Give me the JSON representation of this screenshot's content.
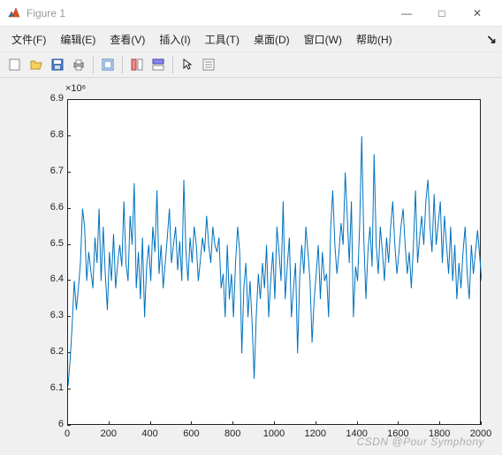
{
  "window": {
    "title": "Figure 1",
    "minimize": "—",
    "maximize": "□",
    "close": "✕"
  },
  "menubar": {
    "items": [
      {
        "label": "文件(F)"
      },
      {
        "label": "编辑(E)"
      },
      {
        "label": "查看(V)"
      },
      {
        "label": "插入(I)"
      },
      {
        "label": "工具(T)"
      },
      {
        "label": "桌面(D)"
      },
      {
        "label": "窗口(W)"
      },
      {
        "label": "帮助(H)"
      }
    ],
    "overflow": "↘"
  },
  "toolbar": {
    "new": "new-figure-icon",
    "open": "open-icon",
    "save": "save-icon",
    "print": "print-icon",
    "edit": "edit-plot-icon",
    "layout1": "layout-icon",
    "layout2": "layout2-icon",
    "pointer": "pointer-icon",
    "props": "properties-icon"
  },
  "watermark": "CSDN @Pour Symphony",
  "chart_data": {
    "type": "line",
    "x_range": [
      0,
      2000
    ],
    "y_range": [
      6.0,
      6.9
    ],
    "y_scale_exponent": "×10⁶",
    "x_ticks": [
      0,
      200,
      400,
      600,
      800,
      1000,
      1200,
      1400,
      1600,
      1800,
      2000
    ],
    "y_ticks": [
      6.0,
      6.1,
      6.2,
      6.3,
      6.4,
      6.5,
      6.6,
      6.7,
      6.8,
      6.9
    ],
    "y_tick_labels": [
      "6",
      "6.1",
      "6.2",
      "6.3",
      "6.4",
      "6.5",
      "6.6",
      "6.7",
      "6.8",
      "6.9"
    ],
    "title": "",
    "xlabel": "",
    "ylabel": "",
    "line_color": "#0072bd",
    "values": [
      6.11,
      6.18,
      6.28,
      6.4,
      6.32,
      6.38,
      6.45,
      6.6,
      6.55,
      6.4,
      6.48,
      6.43,
      6.38,
      6.52,
      6.45,
      6.6,
      6.4,
      6.55,
      6.42,
      6.32,
      6.48,
      6.4,
      6.53,
      6.38,
      6.45,
      6.5,
      6.44,
      6.62,
      6.45,
      6.4,
      6.58,
      6.5,
      6.67,
      6.38,
      6.48,
      6.35,
      6.52,
      6.3,
      6.44,
      6.5,
      6.4,
      6.55,
      6.48,
      6.65,
      6.42,
      6.5,
      6.38,
      6.45,
      6.52,
      6.6,
      6.45,
      6.5,
      6.55,
      6.43,
      6.51,
      6.4,
      6.68,
      6.48,
      6.4,
      6.52,
      6.45,
      6.55,
      6.5,
      6.4,
      6.46,
      6.52,
      6.48,
      6.58,
      6.5,
      6.45,
      6.55,
      6.5,
      6.48,
      6.52,
      6.38,
      6.42,
      6.3,
      6.5,
      6.35,
      6.42,
      6.3,
      6.45,
      6.55,
      6.48,
      6.2,
      6.38,
      6.45,
      6.3,
      6.4,
      6.28,
      6.13,
      6.3,
      6.42,
      6.35,
      6.45,
      6.38,
      6.5,
      6.3,
      6.4,
      6.48,
      6.35,
      6.55,
      6.48,
      6.4,
      6.62,
      6.35,
      6.44,
      6.52,
      6.3,
      6.38,
      6.45,
      6.2,
      6.41,
      6.5,
      6.42,
      6.55,
      6.48,
      6.4,
      6.23,
      6.35,
      6.42,
      6.5,
      6.35,
      6.48,
      6.4,
      6.42,
      6.3,
      6.55,
      6.65,
      6.5,
      6.42,
      6.48,
      6.56,
      6.5,
      6.7,
      6.58,
      6.45,
      6.62,
      6.3,
      6.44,
      6.4,
      6.55,
      6.8,
      6.52,
      6.35,
      6.48,
      6.55,
      6.44,
      6.75,
      6.5,
      6.42,
      6.55,
      6.48,
      6.4,
      6.52,
      6.45,
      6.55,
      6.62,
      6.5,
      6.42,
      6.48,
      6.55,
      6.6,
      6.5,
      6.42,
      6.48,
      6.38,
      6.5,
      6.65,
      6.45,
      6.52,
      6.58,
      6.5,
      6.62,
      6.68,
      6.55,
      6.48,
      6.64,
      6.5,
      6.56,
      6.62,
      6.45,
      6.58,
      6.5,
      6.42,
      6.55,
      6.4,
      6.5,
      6.35,
      6.45,
      6.38,
      6.48,
      6.55,
      6.42,
      6.35,
      6.5,
      6.42,
      6.48,
      6.54,
      6.47,
      6.4
    ]
  }
}
